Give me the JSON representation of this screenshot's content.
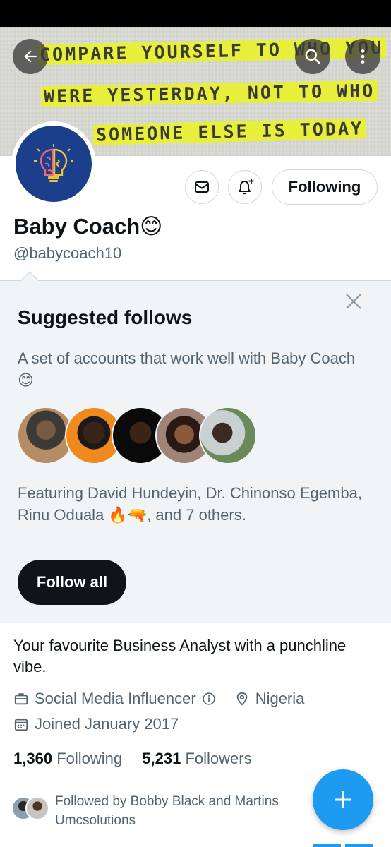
{
  "banner": {
    "line1": "COMPARE YOURSELF TO WHO YOU",
    "line2": "WERE YESTERDAY, NOT TO WHO",
    "line3": "SOMEONE ELSE IS TODAY",
    "highlight_color": "#e8ef3a"
  },
  "top_bar": {
    "back_icon": "arrow-left-icon",
    "search_icon": "search-icon",
    "more_icon": "more-vertical-icon"
  },
  "profile": {
    "avatar_icon": "brain-lightbulb-icon",
    "avatar_bg": "#1c3f8c",
    "display_name": "Baby Coach😊",
    "handle": "@babycoach10",
    "following_label": "Following",
    "bio": "Your favourite Business Analyst with a punchline vibe.",
    "category": "Social Media Influencer",
    "location": "Nigeria",
    "joined": "Joined January 2017",
    "following_count": "1,360",
    "following_label_text": "Following",
    "followers_count": "5,231",
    "followers_label_text": "Followers",
    "followed_by": "Followed by Bobby Black and Martins Umcsolutions"
  },
  "suggested": {
    "title": "Suggested follows",
    "description": "A set of accounts that work well with Baby Coach😊",
    "featuring": "Featuring David Hundeyin, Dr. Chinonso Egemba, Rinu Oduala 🔥🔫, and 7 others.",
    "follow_all_label": "Follow all"
  },
  "colors": {
    "accent": "#1d9bf0",
    "text_primary": "#0f1419",
    "text_secondary": "#536471"
  }
}
